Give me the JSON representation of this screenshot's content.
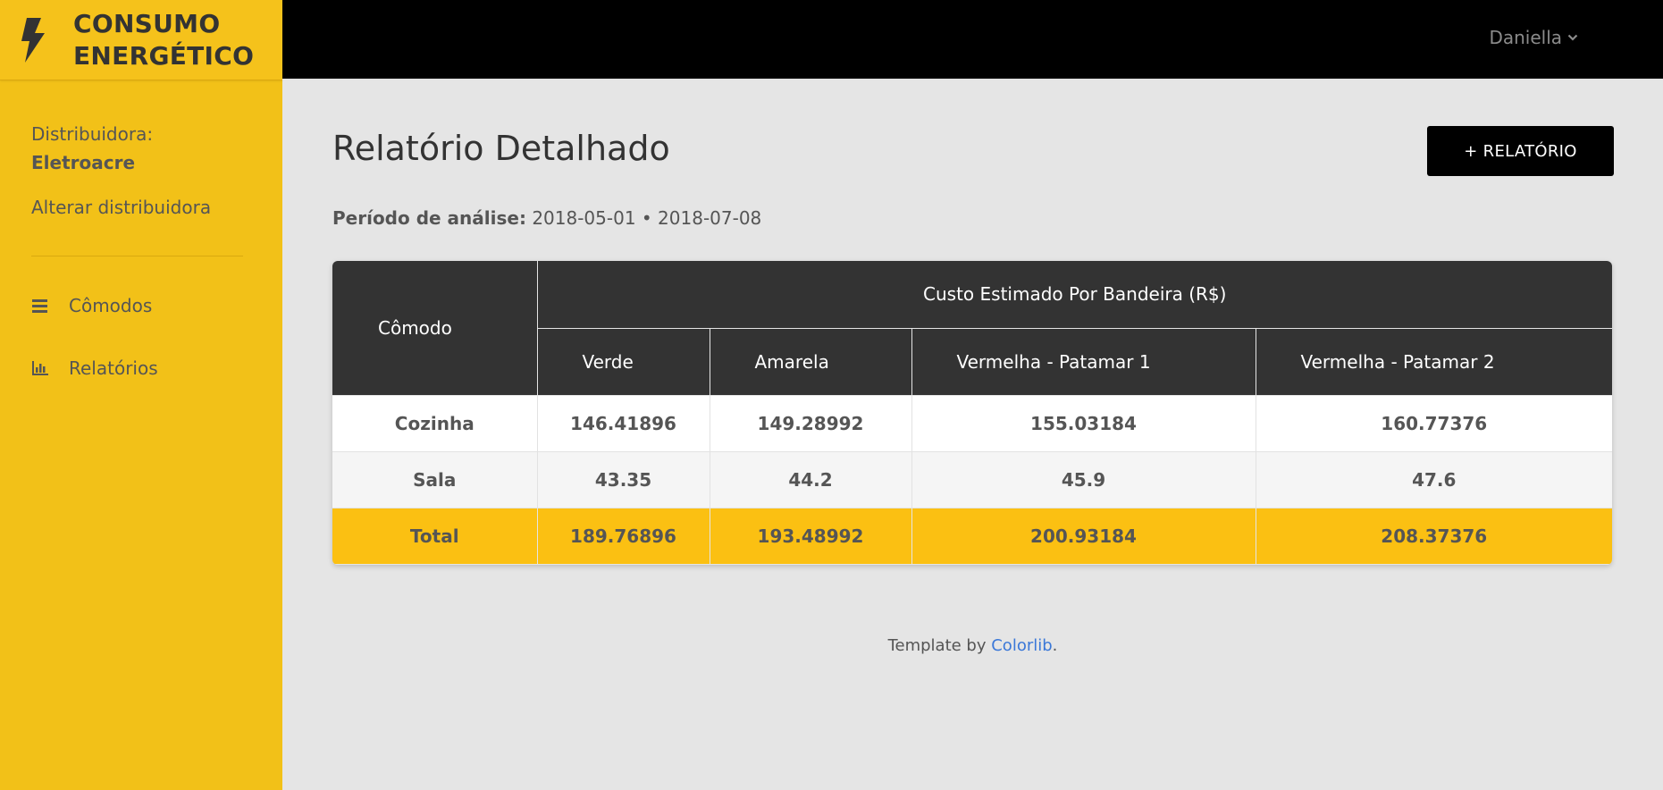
{
  "brand": {
    "line1": "CONSUMO",
    "line2": "ENERGÉTICO",
    "icon": "bolt-icon"
  },
  "sidebar": {
    "distributor_label": "Distribuidora:",
    "distributor_name": "Eletroacre",
    "change_distributor": "Alterar distribuidora",
    "items": [
      {
        "label": "Cômodos",
        "icon": "bars-icon"
      },
      {
        "label": "Relatórios",
        "icon": "bar-chart-icon"
      }
    ]
  },
  "topbar": {
    "user_name": "Daniella",
    "user_icon": "chevron-down-icon"
  },
  "main": {
    "title": "Relatório Detalhado",
    "add_button": "+ RELATÓRIO",
    "period_label": "Período de análise:",
    "period_value": "2018-05-01 • 2018-07-08"
  },
  "table": {
    "room_header": "Cômodo",
    "group_header": "Custo Estimado Por Bandeira (R$)",
    "columns": [
      "Verde",
      "Amarela",
      "Vermelha - Patamar 1",
      "Vermelha - Patamar 2"
    ],
    "rows": [
      {
        "room": "Cozinha",
        "values": [
          "146.41896",
          "149.28992",
          "155.03184",
          "160.77376"
        ]
      },
      {
        "room": "Sala",
        "values": [
          "43.35",
          "44.2",
          "45.9",
          "47.6"
        ]
      },
      {
        "room": "Total",
        "values": [
          "189.76896",
          "193.48992",
          "200.93184",
          "208.37376"
        ]
      }
    ]
  },
  "footer": {
    "prefix": "Template by ",
    "link": "Colorlib",
    "suffix": "."
  },
  "colors": {
    "sidebar": "#f2c118",
    "topbar": "#000000",
    "total_row": "#fbc012",
    "header": "#333333"
  }
}
